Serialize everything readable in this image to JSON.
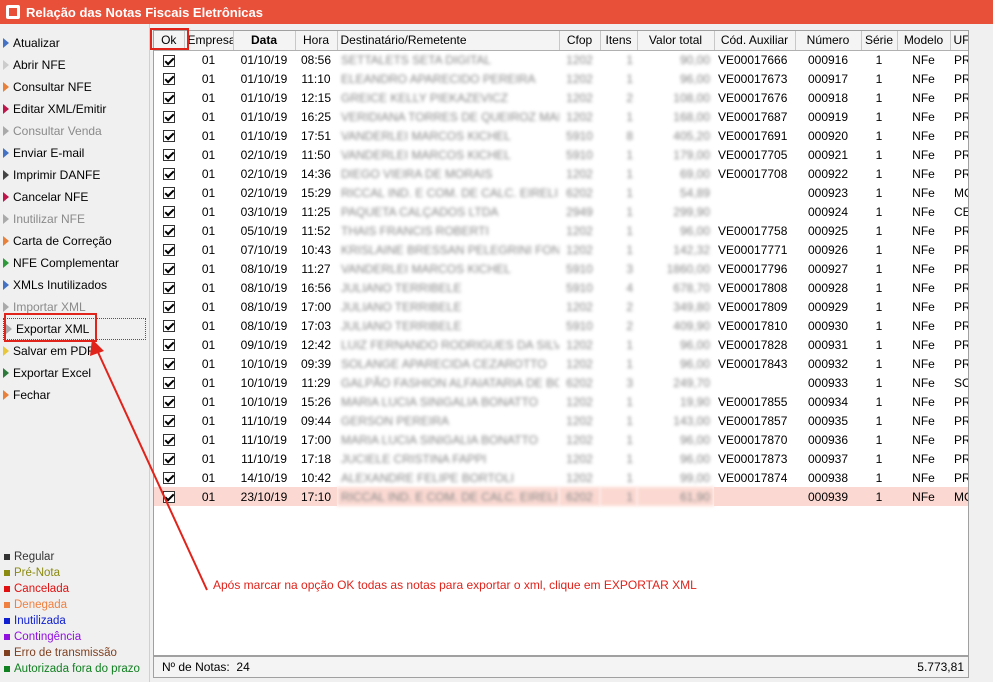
{
  "window": {
    "title": "Relação das Notas Fiscais Eletrônicas",
    "icon": "app-icon"
  },
  "menu": [
    {
      "label": "Atualizar",
      "color": "#4472c4",
      "disabled": false,
      "selected": false
    },
    {
      "label": "Abrir NFE",
      "color": "#cccccc",
      "disabled": false,
      "selected": false
    },
    {
      "label": "Consultar NFE",
      "color": "#e8803a",
      "disabled": false,
      "selected": false
    },
    {
      "label": "Editar XML/Emitir",
      "color": "#c0154a",
      "disabled": false,
      "selected": false
    },
    {
      "label": "Consultar Venda",
      "color": "#aaaaaa",
      "disabled": true,
      "selected": false
    },
    {
      "label": "Enviar E-mail",
      "color": "#4472c4",
      "disabled": false,
      "selected": false
    },
    {
      "label": "Imprimir DANFE",
      "color": "#444444",
      "disabled": false,
      "selected": false
    },
    {
      "label": "Cancelar NFE",
      "color": "#c0154a",
      "disabled": false,
      "selected": false
    },
    {
      "label": "Inutilizar NFE",
      "color": "#aaaaaa",
      "disabled": true,
      "selected": false
    },
    {
      "label": "Carta de Correção",
      "color": "#e8803a",
      "disabled": false,
      "selected": false
    },
    {
      "label": "NFE Complementar",
      "color": "#2e9a3a",
      "disabled": false,
      "selected": false
    },
    {
      "label": "XMLs Inutilizados",
      "color": "#4472c4",
      "disabled": false,
      "selected": false
    },
    {
      "label": "Importar XML",
      "color": "#aaaaaa",
      "disabled": true,
      "selected": false
    },
    {
      "label": "Exportar XML",
      "color": "#aaaaaa",
      "disabled": false,
      "selected": true
    },
    {
      "label": "Salvar em PDF",
      "color": "#e8c83a",
      "disabled": false,
      "selected": false
    },
    {
      "label": "Exportar Excel",
      "color": "#2e7a3a",
      "disabled": false,
      "selected": false
    },
    {
      "label": "Fechar",
      "color": "#e8803a",
      "disabled": false,
      "selected": false
    }
  ],
  "legend": [
    {
      "label": "Regular",
      "color": "#333333"
    },
    {
      "label": "Pré-Nota",
      "color": "#8a8a10"
    },
    {
      "label": "Cancelada",
      "color": "#e01010"
    },
    {
      "label": "Denegada",
      "color": "#f08040"
    },
    {
      "label": "Inutilizada",
      "color": "#1020d0"
    },
    {
      "label": "Contingência",
      "color": "#9010e0"
    },
    {
      "label": "Erro de transmissão",
      "color": "#804020"
    },
    {
      "label": "Autorizada fora do prazo",
      "color": "#108020"
    }
  ],
  "grid": {
    "columns": [
      "Ok",
      "Empresa",
      "Data",
      "Hora",
      "Destinatário/Remetente",
      "Cfop",
      "Itens",
      "Valor total",
      "Cód. Auxiliar",
      "Número",
      "Série",
      "Modelo",
      "UF"
    ],
    "rows": [
      {
        "empresa": "01",
        "data": "01/10/19",
        "hora": "08:56",
        "dest": "SETTALETS SETA DIGITAL",
        "cfop": "1202",
        "itens": "1",
        "valor": "90,00",
        "cod": "VE00017666",
        "numero": "000916",
        "serie": "1",
        "modelo": "NFe",
        "uf": "PR"
      },
      {
        "empresa": "01",
        "data": "01/10/19",
        "hora": "11:10",
        "dest": "ELEANDRO APARECIDO PEREIRA",
        "cfop": "1202",
        "itens": "1",
        "valor": "96,00",
        "cod": "VE00017673",
        "numero": "000917",
        "serie": "1",
        "modelo": "NFe",
        "uf": "PR"
      },
      {
        "empresa": "01",
        "data": "01/10/19",
        "hora": "12:15",
        "dest": "GREICE KELLY PIEKAZEVICZ",
        "cfop": "1202",
        "itens": "2",
        "valor": "108,00",
        "cod": "VE00017676",
        "numero": "000918",
        "serie": "1",
        "modelo": "NFe",
        "uf": "PR"
      },
      {
        "empresa": "01",
        "data": "01/10/19",
        "hora": "16:25",
        "dest": "VERIDIANA TORRES DE QUEIROZ MARDEI",
        "cfop": "1202",
        "itens": "1",
        "valor": "168,00",
        "cod": "VE00017687",
        "numero": "000919",
        "serie": "1",
        "modelo": "NFe",
        "uf": "PR"
      },
      {
        "empresa": "01",
        "data": "01/10/19",
        "hora": "17:51",
        "dest": "VANDERLEI MARCOS KICHEL",
        "cfop": "5910",
        "itens": "8",
        "valor": "405,20",
        "cod": "VE00017691",
        "numero": "000920",
        "serie": "1",
        "modelo": "NFe",
        "uf": "PR"
      },
      {
        "empresa": "01",
        "data": "02/10/19",
        "hora": "11:50",
        "dest": "VANDERLEI MARCOS KICHEL",
        "cfop": "5910",
        "itens": "1",
        "valor": "179,00",
        "cod": "VE00017705",
        "numero": "000921",
        "serie": "1",
        "modelo": "NFe",
        "uf": "PR"
      },
      {
        "empresa": "01",
        "data": "02/10/19",
        "hora": "14:36",
        "dest": "DIEGO VIEIRA DE MORAIS",
        "cfop": "1202",
        "itens": "1",
        "valor": "69,00",
        "cod": "VE00017708",
        "numero": "000922",
        "serie": "1",
        "modelo": "NFe",
        "uf": "PR"
      },
      {
        "empresa": "01",
        "data": "02/10/19",
        "hora": "15:29",
        "dest": "RICCAL IND. E COM. DE CALC. EIRELI",
        "cfop": "6202",
        "itens": "1",
        "valor": "54,89",
        "cod": "",
        "numero": "000923",
        "serie": "1",
        "modelo": "NFe",
        "uf": "MG"
      },
      {
        "empresa": "01",
        "data": "03/10/19",
        "hora": "11:25",
        "dest": "PAQUETA CALÇADOS LTDA",
        "cfop": "2949",
        "itens": "1",
        "valor": "299,90",
        "cod": "",
        "numero": "000924",
        "serie": "1",
        "modelo": "NFe",
        "uf": "CE"
      },
      {
        "empresa": "01",
        "data": "05/10/19",
        "hora": "11:52",
        "dest": "THAIS FRANCIS ROBERTI",
        "cfop": "1202",
        "itens": "1",
        "valor": "96,00",
        "cod": "VE00017758",
        "numero": "000925",
        "serie": "1",
        "modelo": "NFe",
        "uf": "PR"
      },
      {
        "empresa": "01",
        "data": "07/10/19",
        "hora": "10:43",
        "dest": "KRISLAINE BRESSAN PELEGRINI FONSECA",
        "cfop": "1202",
        "itens": "1",
        "valor": "142,32",
        "cod": "VE00017771",
        "numero": "000926",
        "serie": "1",
        "modelo": "NFe",
        "uf": "PR"
      },
      {
        "empresa": "01",
        "data": "08/10/19",
        "hora": "11:27",
        "dest": "VANDERLEI MARCOS KICHEL",
        "cfop": "5910",
        "itens": "3",
        "valor": "1860,00",
        "cod": "VE00017796",
        "numero": "000927",
        "serie": "1",
        "modelo": "NFe",
        "uf": "PR"
      },
      {
        "empresa": "01",
        "data": "08/10/19",
        "hora": "16:56",
        "dest": "JULIANO TERRIBELE",
        "cfop": "5910",
        "itens": "4",
        "valor": "678,70",
        "cod": "VE00017808",
        "numero": "000928",
        "serie": "1",
        "modelo": "NFe",
        "uf": "PR"
      },
      {
        "empresa": "01",
        "data": "08/10/19",
        "hora": "17:00",
        "dest": "JULIANO TERRIBELE",
        "cfop": "1202",
        "itens": "2",
        "valor": "349,80",
        "cod": "VE00017809",
        "numero": "000929",
        "serie": "1",
        "modelo": "NFe",
        "uf": "PR"
      },
      {
        "empresa": "01",
        "data": "08/10/19",
        "hora": "17:03",
        "dest": "JULIANO TERRIBELE",
        "cfop": "5910",
        "itens": "2",
        "valor": "409,90",
        "cod": "VE00017810",
        "numero": "000930",
        "serie": "1",
        "modelo": "NFe",
        "uf": "PR"
      },
      {
        "empresa": "01",
        "data": "09/10/19",
        "hora": "12:42",
        "dest": "LUIZ FERNANDO RODRIGUES DA SILVA",
        "cfop": "1202",
        "itens": "1",
        "valor": "96,00",
        "cod": "VE00017828",
        "numero": "000931",
        "serie": "1",
        "modelo": "NFe",
        "uf": "PR"
      },
      {
        "empresa": "01",
        "data": "10/10/19",
        "hora": "09:39",
        "dest": "SOLANGE APARECIDA CEZAROTTO",
        "cfop": "1202",
        "itens": "1",
        "valor": "96,00",
        "cod": "VE00017843",
        "numero": "000932",
        "serie": "1",
        "modelo": "NFe",
        "uf": "PR"
      },
      {
        "empresa": "01",
        "data": "10/10/19",
        "hora": "11:29",
        "dest": "GALPÃO FASHION ALFAIATARIA DE BOLSAS",
        "cfop": "6202",
        "itens": "3",
        "valor": "249,70",
        "cod": "",
        "numero": "000933",
        "serie": "1",
        "modelo": "NFe",
        "uf": "SC"
      },
      {
        "empresa": "01",
        "data": "10/10/19",
        "hora": "15:26",
        "dest": "MARIA LUCIA SINIGALIA BONATTO",
        "cfop": "1202",
        "itens": "1",
        "valor": "19,90",
        "cod": "VE00017855",
        "numero": "000934",
        "serie": "1",
        "modelo": "NFe",
        "uf": "PR"
      },
      {
        "empresa": "01",
        "data": "11/10/19",
        "hora": "09:44",
        "dest": "GERSON PEREIRA",
        "cfop": "1202",
        "itens": "1",
        "valor": "143,00",
        "cod": "VE00017857",
        "numero": "000935",
        "serie": "1",
        "modelo": "NFe",
        "uf": "PR"
      },
      {
        "empresa": "01",
        "data": "11/10/19",
        "hora": "17:00",
        "dest": "MARIA LUCIA SINIGALIA BONATTO",
        "cfop": "1202",
        "itens": "1",
        "valor": "96,00",
        "cod": "VE00017870",
        "numero": "000936",
        "serie": "1",
        "modelo": "NFe",
        "uf": "PR"
      },
      {
        "empresa": "01",
        "data": "11/10/19",
        "hora": "17:18",
        "dest": "JUCIELE CRISTINA FAPPI",
        "cfop": "1202",
        "itens": "1",
        "valor": "96,00",
        "cod": "VE00017873",
        "numero": "000937",
        "serie": "1",
        "modelo": "NFe",
        "uf": "PR"
      },
      {
        "empresa": "01",
        "data": "14/10/19",
        "hora": "10:42",
        "dest": "ALEXANDRE FELIPE BORTOLI",
        "cfop": "1202",
        "itens": "1",
        "valor": "99,00",
        "cod": "VE00017874",
        "numero": "000938",
        "serie": "1",
        "modelo": "NFe",
        "uf": "PR"
      },
      {
        "empresa": "01",
        "data": "23/10/19",
        "hora": "17:10",
        "dest": "RICCAL IND. E COM. DE CALC. EIRELI",
        "cfop": "6202",
        "itens": "1",
        "valor": "61,90",
        "cod": "",
        "numero": "000939",
        "serie": "1",
        "modelo": "NFe",
        "uf": "MG",
        "selected": true
      }
    ]
  },
  "footer": {
    "label": "Nº de Notas:",
    "count": "24",
    "total": "5.773,81"
  },
  "annotation": {
    "text": "Após marcar na opção OK todas as notas para exportar o xml, clique em EXPORTAR XML",
    "color": "#e0231b"
  }
}
